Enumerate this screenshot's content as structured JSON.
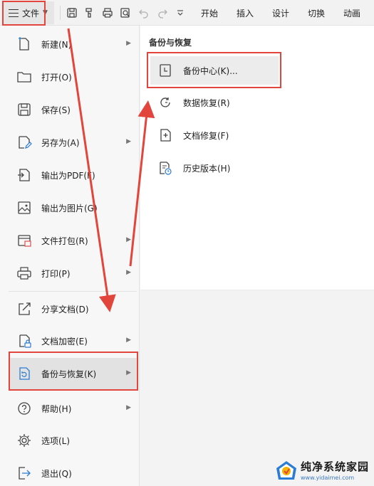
{
  "toolbar": {
    "file_label": "文件",
    "tabs": [
      "开始",
      "插入",
      "设计",
      "切换",
      "动画"
    ]
  },
  "file_menu": {
    "items": [
      {
        "label": "新建(N)",
        "icon": "new-file-icon",
        "submenu": true
      },
      {
        "label": "打开(O)",
        "icon": "folder-icon",
        "submenu": false
      },
      {
        "label": "保存(S)",
        "icon": "save-icon",
        "submenu": false
      },
      {
        "label": "另存为(A)",
        "icon": "save-as-icon",
        "submenu": true
      },
      {
        "label": "输出为PDF(F)",
        "icon": "export-pdf-icon",
        "submenu": false
      },
      {
        "label": "输出为图片(G)",
        "icon": "export-image-icon",
        "submenu": false
      },
      {
        "label": "文件打包(R)",
        "icon": "package-icon",
        "submenu": true
      },
      {
        "label": "打印(P)",
        "icon": "print-icon",
        "submenu": true
      },
      {
        "label": "分享文档(D)",
        "icon": "share-icon",
        "submenu": false
      },
      {
        "label": "文档加密(E)",
        "icon": "encrypt-icon",
        "submenu": true
      },
      {
        "label": "备份与恢复(K)",
        "icon": "backup-restore-icon",
        "submenu": true,
        "active": true
      },
      {
        "label": "帮助(H)",
        "icon": "help-icon",
        "submenu": true
      },
      {
        "label": "选项(L)",
        "icon": "options-gear-icon",
        "submenu": false
      },
      {
        "label": "退出(Q)",
        "icon": "exit-icon",
        "submenu": false
      }
    ]
  },
  "backup_submenu": {
    "title": "备份与恢复",
    "items": [
      {
        "label": "备份中心(K)...",
        "icon": "backup-center-icon",
        "active": true
      },
      {
        "label": "数据恢复(R)",
        "icon": "data-recovery-icon"
      },
      {
        "label": "文档修复(F)",
        "icon": "document-repair-icon"
      },
      {
        "label": "历史版本(H)",
        "icon": "history-version-icon"
      }
    ]
  },
  "watermark": {
    "name": "纯净系统家园",
    "url": "www.yidaimei.com"
  },
  "colors": {
    "highlight_red": "#e2453c",
    "menu_bg": "#f7f7f7",
    "active_bg": "#e2e2e2"
  }
}
